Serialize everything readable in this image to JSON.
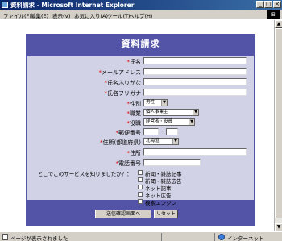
{
  "window": {
    "title": "資料請求 - Microsoft Internet Explorer"
  },
  "menu": [
    "ファイル(F)",
    "編集(E)",
    "表示(V)",
    "お気に入り(A)",
    "ツール(T)",
    "ヘルプ(H)"
  ],
  "form": {
    "heading": "資料請求",
    "fields": {
      "name": "氏名",
      "email": "メールアドレス",
      "name_hiragana": "氏名ふりがな",
      "name_katakana": "氏名フリガナ",
      "gender": "性別",
      "occupation": "職業",
      "position": "役職",
      "postal": "郵便番号",
      "prefecture": "住所(都道府県)",
      "address": "住所",
      "phone": "電話番号"
    },
    "required_mark": "*",
    "selects": {
      "gender": "男性",
      "occupation": "個人事業主",
      "position": "経営者・役員",
      "prefecture": "北海道"
    },
    "postal_sep": "-",
    "question": "どこでこのサービスを知りましたか？：",
    "options": [
      "新聞・雑誌記事",
      "新聞・雑誌広告",
      "ネット記事",
      "ネット広告",
      "検索エンジン"
    ],
    "submit_label": "送信確認画面へ",
    "reset_label": "リセット"
  },
  "status": {
    "text": "ページが表示されました",
    "zone": "インターネット"
  }
}
